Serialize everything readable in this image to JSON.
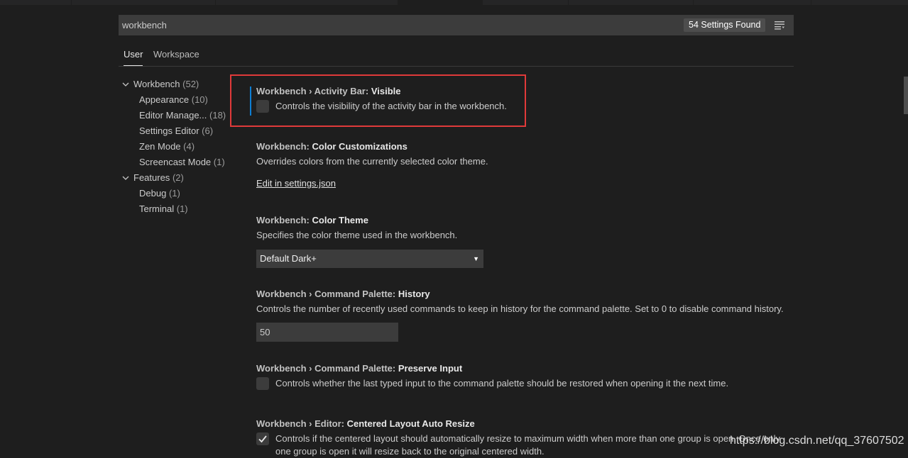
{
  "search": {
    "value": "workbench",
    "results_count": "54 Settings Found",
    "filter_icon": "filter-icon"
  },
  "tabs": [
    {
      "label": "User",
      "active": true
    },
    {
      "label": "Workspace",
      "active": false
    }
  ],
  "toc": {
    "items": [
      {
        "label": "Workbench",
        "count": "(52)",
        "expanded": true
      },
      {
        "label": "Appearance",
        "count": "(10)"
      },
      {
        "label": "Editor Manage...",
        "count": "(18)"
      },
      {
        "label": "Settings Editor",
        "count": "(6)"
      },
      {
        "label": "Zen Mode",
        "count": "(4)"
      },
      {
        "label": "Screencast Mode",
        "count": "(1)"
      },
      {
        "label": "Features",
        "count": "(2)",
        "expanded": true
      },
      {
        "label": "Debug",
        "count": "(1)"
      },
      {
        "label": "Terminal",
        "count": "(1)"
      }
    ]
  },
  "settings": {
    "activity_bar": {
      "category": "Workbench › Activity Bar: ",
      "key": "Visible",
      "description": "Controls the visibility of the activity bar in the workbench.",
      "checked": false
    },
    "color_customizations": {
      "category": "Workbench: ",
      "key": "Color Customizations",
      "description": "Overrides colors from the currently selected color theme.",
      "link": "Edit in settings.json"
    },
    "color_theme": {
      "category": "Workbench: ",
      "key": "Color Theme",
      "description": "Specifies the color theme used in the workbench.",
      "selected": "Default Dark+"
    },
    "command_history": {
      "category": "Workbench › Command Palette: ",
      "key": "History",
      "description": "Controls the number of recently used commands to keep in history for the command palette. Set to 0 to disable command history.",
      "value": "50"
    },
    "preserve_input": {
      "category": "Workbench › Command Palette: ",
      "key": "Preserve Input",
      "description": "Controls whether the last typed input to the command palette should be restored when opening it the next time.",
      "checked": false
    },
    "centered_layout": {
      "category": "Workbench › Editor: ",
      "key": "Centered Layout Auto Resize",
      "description_line1": "Controls if the centered layout should automatically resize to maximum width when more than one group is open. Once only",
      "description_line2": "one group is open it will resize back to the original centered width.",
      "checked": true
    }
  },
  "watermark": "https://blog.csdn.net/qq_37607502",
  "colors": {
    "background": "#1e1e1e",
    "input_bg": "#3c3c3c",
    "focus_accent": "#0e7fd4",
    "highlight_border": "#e03a3a"
  }
}
